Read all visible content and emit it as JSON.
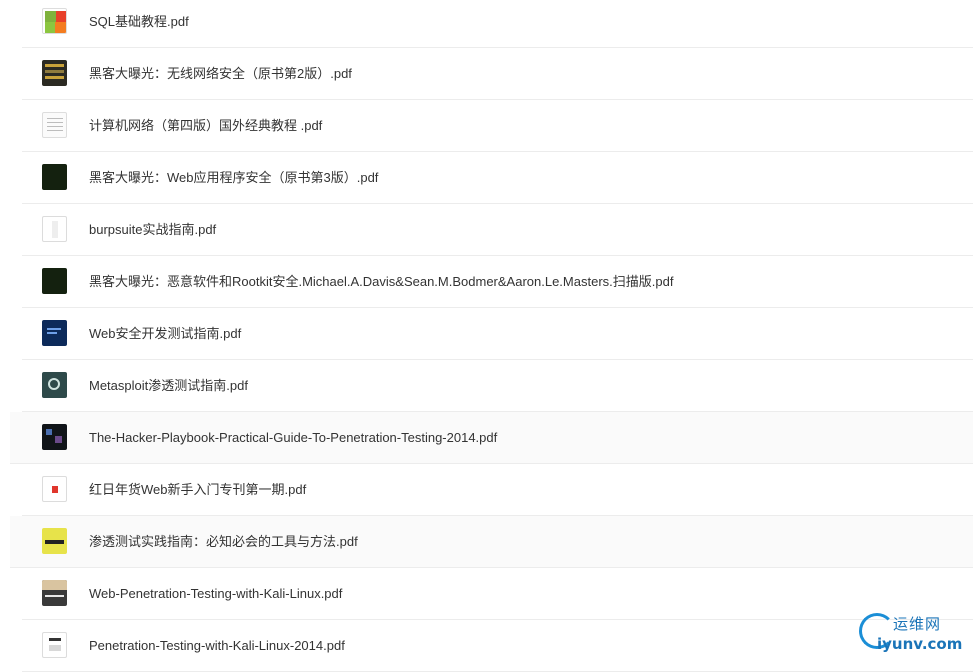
{
  "files": [
    {
      "name": "SQL基础教程.pdf",
      "thumb": "sql-cover"
    },
    {
      "name": "黑客大曝光：无线网络安全（原书第2版）.pdf",
      "thumb": "dark-cover"
    },
    {
      "name": "计算机网络（第四版）国外经典教程 .pdf",
      "thumb": "doc-cover"
    },
    {
      "name": "黑客大曝光：Web应用程序安全（原书第3版）.pdf",
      "thumb": "green-cover"
    },
    {
      "name": "burpsuite实战指南.pdf",
      "thumb": "white-cover"
    },
    {
      "name": "黑客大曝光：恶意软件和Rootkit安全.Michael.A.Davis&Sean.M.Bodmer&Aaron.Le.Masters.扫描版.pdf",
      "thumb": "green-cover"
    },
    {
      "name": "Web安全开发测试指南.pdf",
      "thumb": "blue-cover"
    },
    {
      "name": "Metasploit渗透测试指南.pdf",
      "thumb": "meta-cover"
    },
    {
      "name": "The-Hacker-Playbook-Practical-Guide-To-Penetration-Testing-2014.pdf",
      "thumb": "hacker-cover"
    },
    {
      "name": "红日年货Web新手入门专刊第一期.pdf",
      "thumb": "red-cover"
    },
    {
      "name": "渗透测试实践指南：必知必会的工具与方法.pdf",
      "thumb": "yellow-cover"
    },
    {
      "name": "Web-Penetration-Testing-with-Kali-Linux.pdf",
      "thumb": "kali-cover"
    },
    {
      "name": "Penetration-Testing-with-Kali-Linux-2014.pdf",
      "thumb": "kali2-cover"
    }
  ],
  "watermark": {
    "cn": "运维网",
    "en": "iyunv.com"
  },
  "colors": {
    "text": "#333333",
    "divider": "#ececec",
    "watermark": "#1a74b8"
  }
}
